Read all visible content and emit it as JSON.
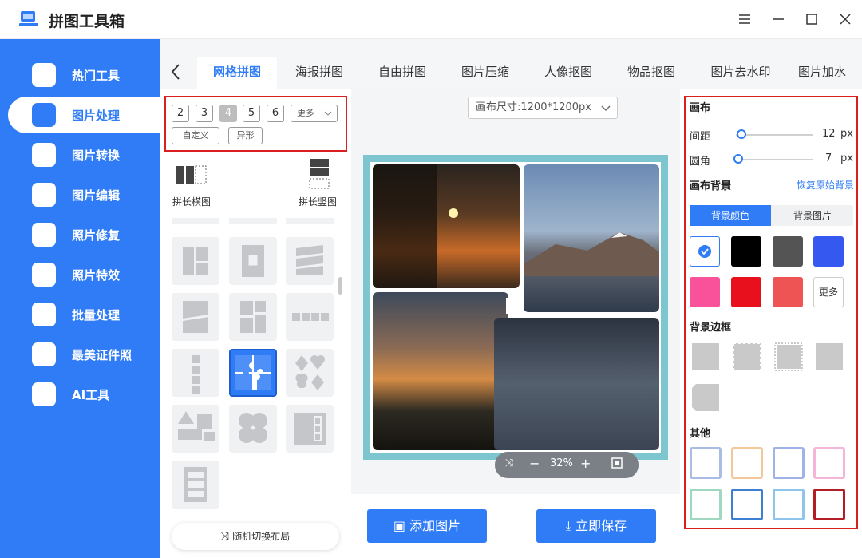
{
  "app": {
    "title": "拼图工具箱"
  },
  "sidebar": {
    "items": [
      {
        "label": "热门工具"
      },
      {
        "label": "图片处理"
      },
      {
        "label": "图片转换"
      },
      {
        "label": "图片编辑"
      },
      {
        "label": "照片修复"
      },
      {
        "label": "照片特效"
      },
      {
        "label": "批量处理"
      },
      {
        "label": "最美证件照"
      },
      {
        "label": "AI工具"
      }
    ],
    "active_index": 1
  },
  "tabs": [
    "网格拼图",
    "海报拼图",
    "自由拼图",
    "图片压缩",
    "人像抠图",
    "物品抠图",
    "图片去水印",
    "图片加水"
  ],
  "active_tab": "网格拼图",
  "grid": {
    "counts": [
      "2",
      "3",
      "4",
      "5",
      "6"
    ],
    "selected_count": "4",
    "more_label": "更多",
    "custom_label": "自定义",
    "irregular_label": "异形",
    "horizontal_label": "拼长横图",
    "vertical_label": "拼长竖图",
    "random_label": "随机切换布局"
  },
  "canvas": {
    "size_label": "画布尺寸:1200*1200px",
    "zoom": "32%"
  },
  "actions": {
    "add_label": "添加图片",
    "save_label": "立即保存"
  },
  "right": {
    "canvas_title": "画布",
    "spacing_label": "间距",
    "spacing_value": "12",
    "radius_label": "圆角",
    "radius_value": "7",
    "unit": "px",
    "bg_title": "画布背景",
    "reset_label": "恢复原始背景",
    "bg_color_tab": "背景颜色",
    "bg_image_tab": "背景图片",
    "colors": [
      "#ffffff",
      "#000000",
      "#545454",
      "#3558f0",
      "#f9529a",
      "#e8101d",
      "#ee5454"
    ],
    "more_label": "更多",
    "border_title": "背景边框",
    "other_title": "其他"
  },
  "colors": {
    "brand": "#2f7cf6",
    "highlight": "#d9201f"
  }
}
